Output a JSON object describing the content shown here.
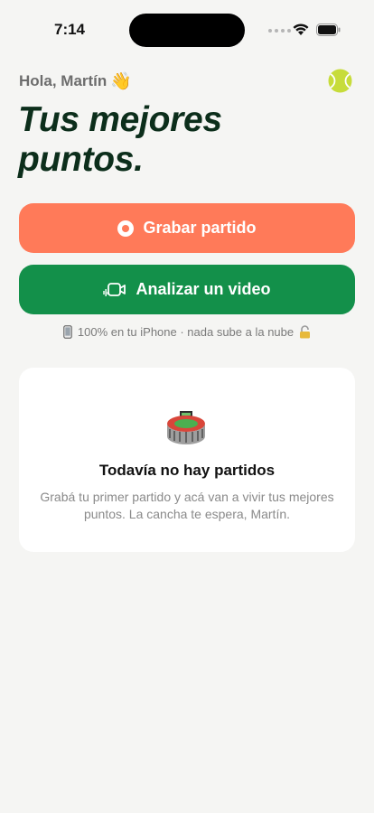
{
  "status_bar": {
    "time": "7:14"
  },
  "header": {
    "greeting": "Hola, Martín",
    "greeting_emoji": "👋",
    "avatar_icon": "tennis-ball-icon",
    "title": "Tus mejores puntos."
  },
  "actions": {
    "record_label": "Grabar partido",
    "analyze_label": "Analizar un video"
  },
  "privacy_note": {
    "text": "100% en tu iPhone · nada sube a la nube"
  },
  "empty_state": {
    "icon": "stadium-icon",
    "title": "Todavía no hay partidos",
    "description": "Grabá tu primer partido y acá van a vivir tus mejores puntos. La cancha te espera, Martín."
  },
  "colors": {
    "background": "#f5f5f3",
    "record_button": "#ff7a59",
    "analyze_button": "#13904a",
    "title": "#0c2e1b"
  }
}
